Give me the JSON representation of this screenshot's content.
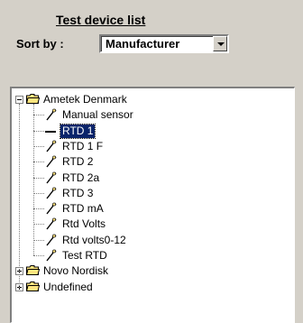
{
  "header": {
    "title": "Test device list",
    "sort_label": "Sort by :",
    "sort_value": "Manufacturer"
  },
  "tree": {
    "groups": [
      {
        "label": "Ametek Denmark",
        "expanded": true,
        "children": [
          {
            "label": "Manual sensor",
            "icon": "probe-icon"
          },
          {
            "label": "RTD 1",
            "icon": "dash-icon",
            "selected": true
          },
          {
            "label": "RTD 1 F",
            "icon": "probe-icon"
          },
          {
            "label": "RTD 2",
            "icon": "probe-icon"
          },
          {
            "label": "RTD 2a",
            "icon": "probe-icon"
          },
          {
            "label": "RTD 3",
            "icon": "probe-icon"
          },
          {
            "label": "RTD mA",
            "icon": "probe-icon"
          },
          {
            "label": "Rtd Volts",
            "icon": "probe-icon"
          },
          {
            "label": "Rtd volts0-12",
            "icon": "probe-icon"
          },
          {
            "label": "Test RTD",
            "icon": "probe-icon"
          }
        ]
      },
      {
        "label": "Novo Nordisk",
        "expanded": false,
        "children": []
      },
      {
        "label": "Undefined",
        "expanded": false,
        "children": []
      }
    ]
  },
  "colors": {
    "window_bg": "#d4d0c8",
    "selection_bg": "#0a246a",
    "folder_yellow": "#ffe680"
  }
}
